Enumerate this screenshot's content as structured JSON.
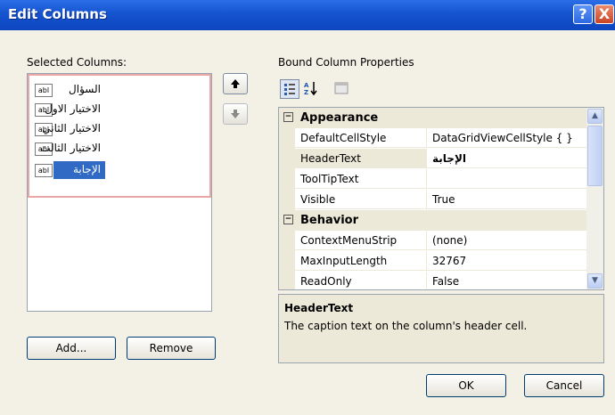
{
  "window": {
    "title": "Edit Columns",
    "help_label": "?",
    "close_label": "X"
  },
  "left": {
    "label": "Selected Columns:",
    "items": [
      {
        "label": "السؤال",
        "icon": "abl"
      },
      {
        "label": "الاختيار الاول",
        "icon": "abl"
      },
      {
        "label": "الاختيار الثاني",
        "icon": "abl"
      },
      {
        "label": "الاختيار الثالث",
        "icon": "abl"
      },
      {
        "label": "الإجابة",
        "icon": "abl",
        "selected": true
      }
    ],
    "add_label": "Add...",
    "remove_label": "Remove"
  },
  "right": {
    "label": "Bound Column Properties",
    "toolbar": [
      "categorized-icon",
      "alphabetical-icon",
      "property-pages-icon"
    ],
    "categories": [
      {
        "name": "Appearance",
        "properties": [
          {
            "name": "DefaultCellStyle",
            "value": "DataGridViewCellStyle { }"
          },
          {
            "name": "HeaderText",
            "value": "الإجابة"
          },
          {
            "name": "ToolTipText",
            "value": ""
          },
          {
            "name": "Visible",
            "value": "True"
          }
        ]
      },
      {
        "name": "Behavior",
        "properties": [
          {
            "name": "ContextMenuStrip",
            "value": "(none)"
          },
          {
            "name": "MaxInputLength",
            "value": "32767"
          },
          {
            "name": "ReadOnly",
            "value": "False"
          }
        ]
      }
    ],
    "description": {
      "title": "HeaderText",
      "text": "The caption text on the column's header cell."
    }
  },
  "buttons": {
    "ok": "OK",
    "cancel": "Cancel"
  },
  "colors": {
    "titlebar": "#1553cf",
    "selection": "#316ac5",
    "dialog_bg": "#f3f0e6"
  }
}
